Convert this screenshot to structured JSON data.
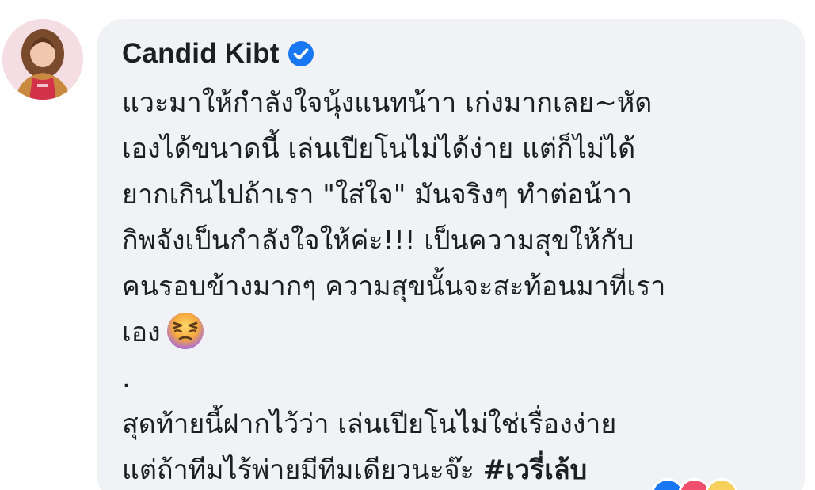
{
  "comment": {
    "author": "Candid Kibt",
    "verified_icon": "verified-badge-icon",
    "lines": [
      "แวะมาให้กำลังใจนุ้งแนทน้าา เก่งมากเลย~หัด",
      "เองได้ขนาดนี้ เล่นเปียโนไม่ได้ง่าย แต่ก็ไม่ได้",
      "ยากเกินไปถ้าเรา \"ใส่ใจ\" มันจริงๆ ทำต่อน้าา",
      "กิพจังเป็นกำลังใจให้ค่ะ!!! เป็นความสุขให้กับ",
      "คนรอบข้างมากๆ ความสุขนั้นจะสะท้อนมาที่เรา",
      "เอง",
      ".",
      "สุดท้ายนี้ฝากไว้ว่า เล่นเปียโนไม่ใช่เรื่องง่าย",
      "แต่ถ้าทีมไร้พ่ายมีทีมเดียวนะจ๊ะ"
    ],
    "hashtag": "#เวรี่เล้บ",
    "emoji": "weary-face-emoji",
    "reaction_icons": [
      "like-reaction-icon",
      "love-reaction-icon",
      "haha-reaction-icon"
    ]
  },
  "colors": {
    "bubble": "#f0f2f5",
    "text": "#1c1e21",
    "verified": "#1877f2"
  }
}
